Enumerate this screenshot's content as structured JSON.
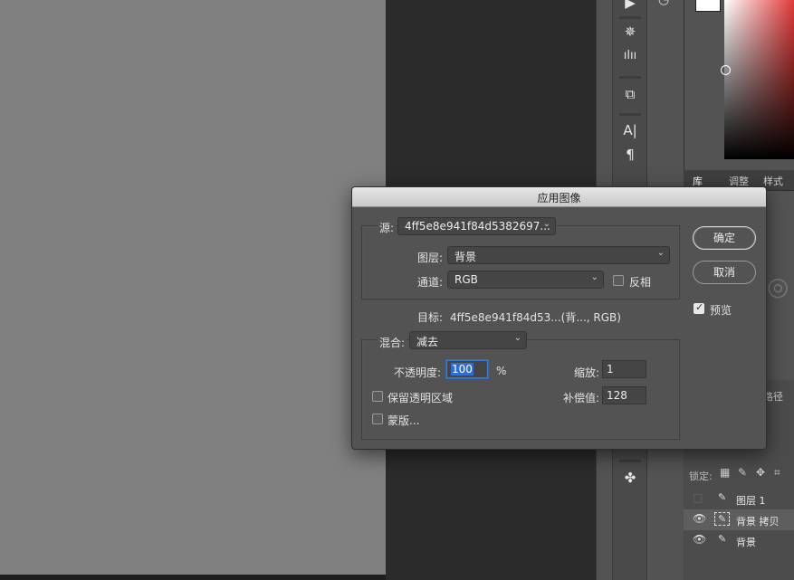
{
  "dialog": {
    "title": "应用图像",
    "source_label": "源:",
    "source_value": "4ff5e8e941f84d5382697...",
    "layer_label": "图层:",
    "layer_value": "背景",
    "channel_label": "通道:",
    "channel_value": "RGB",
    "invert_label": "反相",
    "target_label": "目标:",
    "target_value": "4ff5e8e941f84d53...(背..., RGB)",
    "blending_label": "混合:",
    "blending_value": "减去",
    "opacity_label": "不透明度:",
    "opacity_value": "100",
    "opacity_unit": "%",
    "scale_label": "缩放:",
    "scale_value": "1",
    "offset_label": "补偿值:",
    "offset_value": "128",
    "preserve_label": "保留透明区域",
    "mask_label": "蒙版...",
    "ok_label": "确定",
    "cancel_label": "取消",
    "preview_label": "预览",
    "preview_checked": true,
    "invert_checked": false,
    "preserve_checked": false,
    "mask_checked": false
  },
  "panels": {
    "tabs": [
      "库",
      "调整",
      "样式"
    ],
    "paths_tab": "路径",
    "lock_label": "锁定:",
    "layers": [
      {
        "name": "图层 1",
        "visible": false
      },
      {
        "name": "背景 拷贝",
        "visible": true,
        "selected": true
      },
      {
        "name": "背景",
        "visible": true
      }
    ]
  },
  "colors": {
    "canvas": "#808080",
    "dialog_bg": "#535353",
    "accent": "#2f6fd1"
  }
}
